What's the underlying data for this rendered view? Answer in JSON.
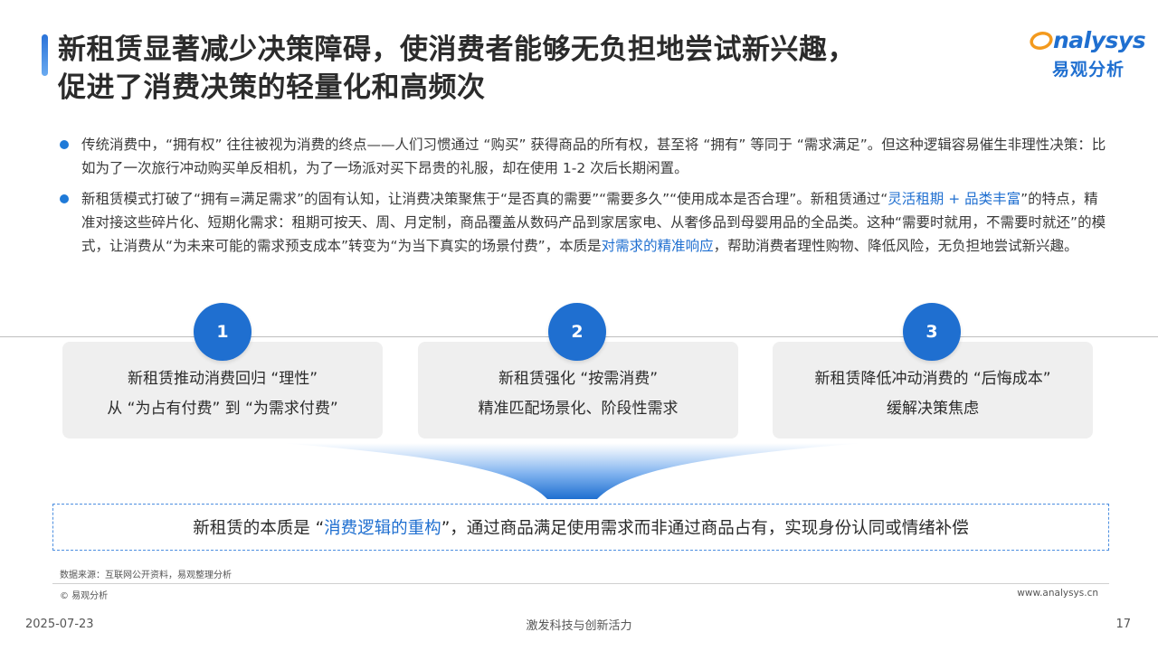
{
  "title": {
    "line1": "新租赁显著减少决策障碍，使消费者能够无负担地尝试新兴趣，",
    "line2": "促进了消费决策的轻量化和高频次"
  },
  "logo": {
    "brand_en": "nalysys",
    "brand_cn": "易观分析"
  },
  "bullets": [
    {
      "text": "传统消费中，“拥有权” 往往被视为消费的终点——人们习惯通过 “购买” 获得商品的所有权，甚至将 “拥有” 等同于 “需求满足”。但这种逻辑容易催生非理性决策：比如为了一次旅行冲动购买单反相机，为了一场派对买下昂贵的礼服，却在使用 1-2 次后长期闲置。"
    },
    {
      "part1": "新租赁模式打破了“拥有=满足需求”的固有认知，让消费决策聚焦于“是否真的需要”“需要多久”“使用成本是否合理”。新租赁通过“",
      "highlight1": "灵活租期 + 品类丰富",
      "part2": "”的特点，精准对接这些碎片化、短期化需求：租期可按天、周、月定制，商品覆盖从数码产品到家居家电、从奢侈品到母婴用品的全品类。这种“需要时就用，不需要时就还”的模式，让消费从“为未来可能的需求预支成本”转变为“为当下真实的场景付费”，本质是",
      "highlight2": "对需求的精准响应",
      "part3": "，帮助消费者理性购物、降低风险，无负担地尝试新兴趣。"
    }
  ],
  "cards": [
    {
      "number": "1",
      "line1": "新租赁推动消费回归 “理性”",
      "line2": "从 “为占有付费” 到 “为需求付费”"
    },
    {
      "number": "2",
      "line1": "新租赁强化 “按需消费”",
      "line2": "精准匹配场景化、阶段性需求"
    },
    {
      "number": "3",
      "line1": "新租赁降低冲动消费的 “后悔成本”",
      "line2": "缓解决策焦虑"
    }
  ],
  "summary": {
    "before": "新租赁的本质是 “",
    "highlight": "消费逻辑的重构",
    "after": "”，通过商品满足使用需求而非通过商品占有，实现身份认同或情绪补偿"
  },
  "footer": {
    "source": "数据来源：互联网公开资料，易观整理分析",
    "copyright": "© 易观分析",
    "website": "www.analysys.cn",
    "date": "2025-07-23",
    "slogan": "激发科技与创新活力",
    "page": "17"
  },
  "colors": {
    "accent": "#1f6fd0",
    "logo_orange": "#f39a1e",
    "card_bg": "#efefef"
  }
}
